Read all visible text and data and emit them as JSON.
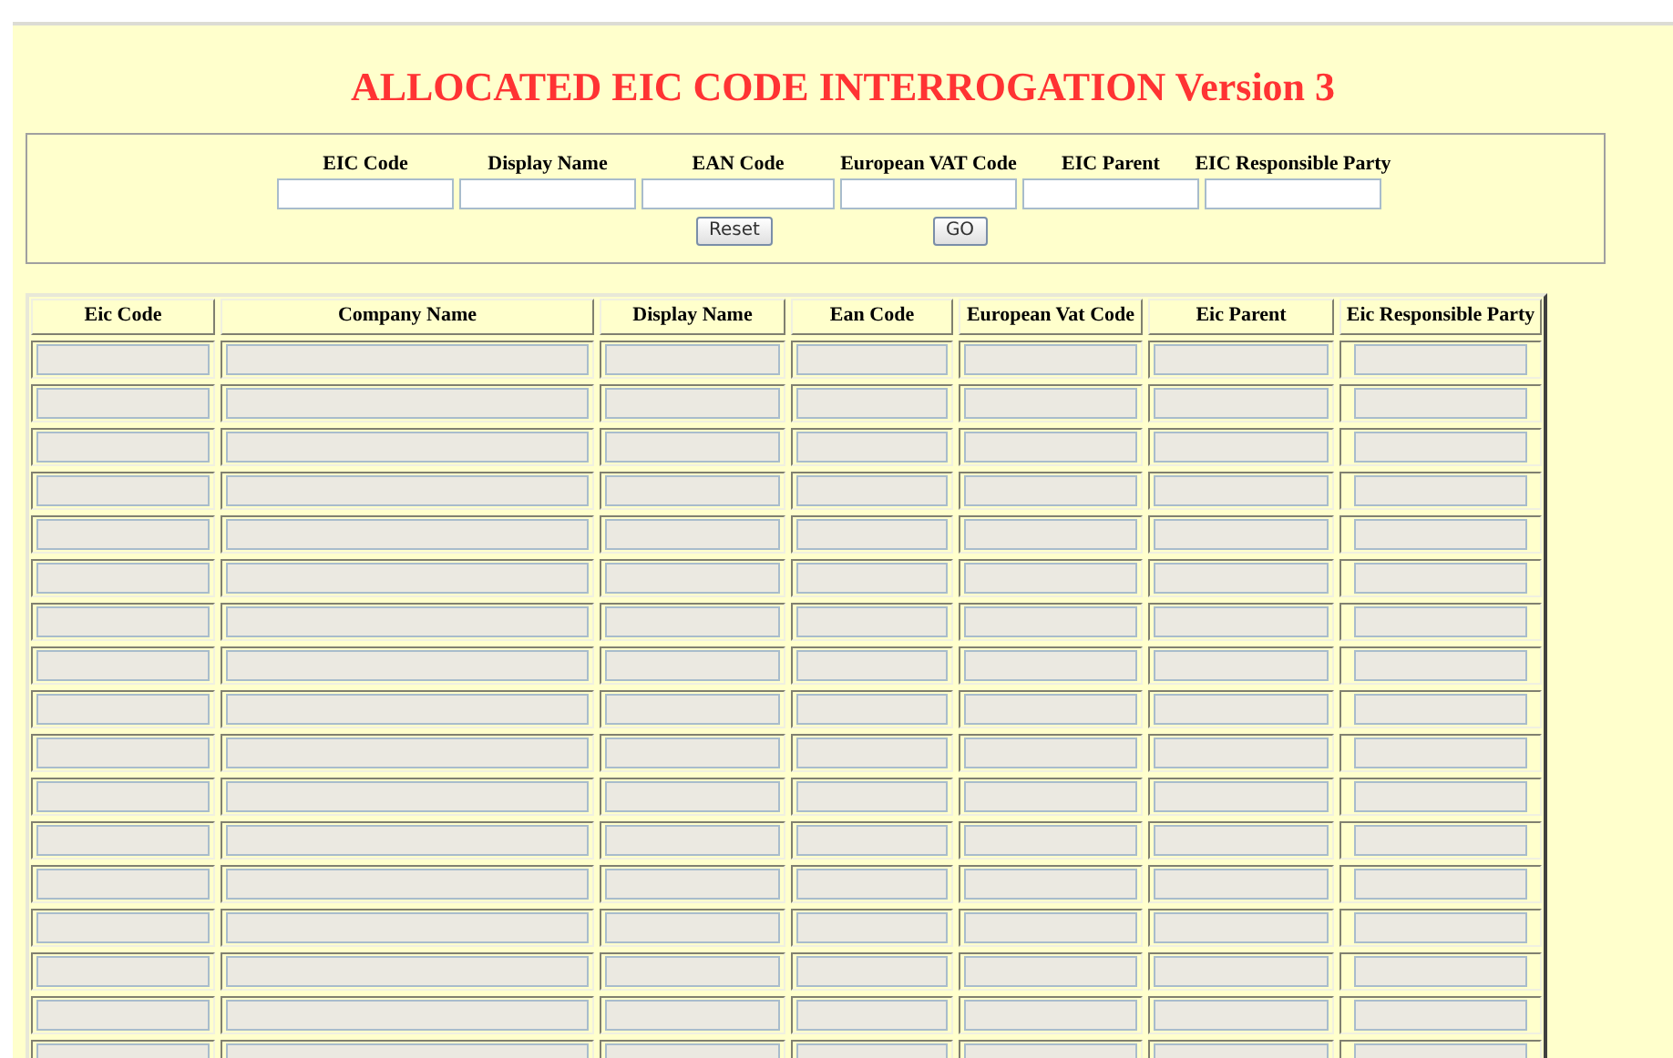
{
  "title": "ALLOCATED EIC CODE INTERROGATION Version 3",
  "search_form": {
    "fields": [
      {
        "label": "EIC Code"
      },
      {
        "label": "Display Name"
      },
      {
        "label": "EAN Code"
      },
      {
        "label": "European VAT Code"
      },
      {
        "label": "EIC Parent"
      },
      {
        "label": "EIC Responsible Party"
      }
    ],
    "buttons": [
      {
        "label": "Reset"
      },
      {
        "label": "GO"
      }
    ]
  },
  "table": {
    "columns": [
      "Eic Code",
      "Company Name",
      "Display Name",
      "Ean Code",
      "European Vat Code",
      "Eic Parent",
      "Eic Responsible Party"
    ],
    "rows": [
      {
        "disabled": true
      },
      {
        "disabled": true
      },
      {
        "disabled": true
      },
      {
        "disabled": true
      },
      {
        "disabled": true
      },
      {
        "disabled": true
      },
      {
        "disabled": true
      },
      {
        "disabled": true
      },
      {
        "disabled": true
      },
      {
        "disabled": true
      },
      {
        "disabled": true
      },
      {
        "disabled": true
      },
      {
        "disabled": true
      },
      {
        "disabled": true
      },
      {
        "disabled": true
      },
      {
        "disabled": true
      },
      {
        "disabled": true
      }
    ]
  }
}
